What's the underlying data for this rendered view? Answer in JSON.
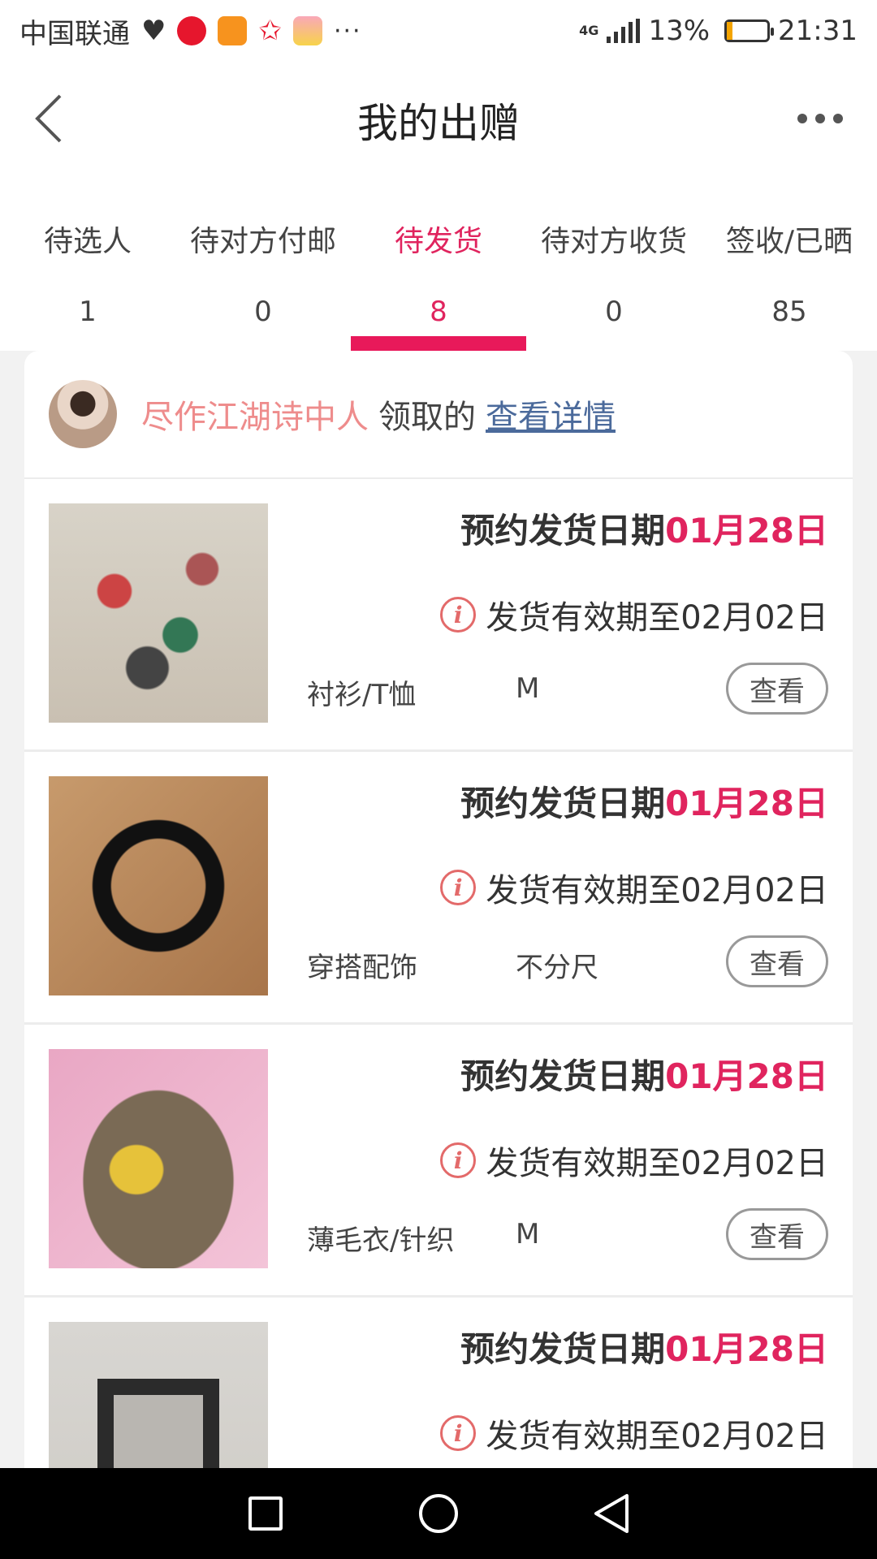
{
  "status_bar": {
    "carrier": "中国联通",
    "more": "···",
    "network": "4G",
    "battery_pct": "13%",
    "battery_level": 0.13,
    "time": "21:31"
  },
  "nav": {
    "title": "我的出赠"
  },
  "tabs": [
    {
      "label": "待选人",
      "count": "1"
    },
    {
      "label": "待对方付邮",
      "count": "0"
    },
    {
      "label": "待发货",
      "count": "8",
      "active": true
    },
    {
      "label": "待对方收货",
      "count": "0"
    },
    {
      "label": "签收/已晒",
      "count": "85"
    }
  ],
  "receiver": {
    "name": "尽作江湖诗中人",
    "claimed_text": "领取的",
    "detail_link": "查看详情"
  },
  "items": [
    {
      "ship_label": "预约发货日期",
      "ship_date": "01月28日",
      "valid_text": "发货有效期至02月02日",
      "category": "衬衫/T恤",
      "size": "M",
      "view_label": "查看"
    },
    {
      "ship_label": "预约发货日期",
      "ship_date": "01月28日",
      "valid_text": "发货有效期至02月02日",
      "category": "穿搭配饰",
      "size": "不分尺",
      "view_label": "查看"
    },
    {
      "ship_label": "预约发货日期",
      "ship_date": "01月28日",
      "valid_text": "发货有效期至02月02日",
      "category": "薄毛衣/针织",
      "size": "M",
      "view_label": "查看"
    },
    {
      "ship_label": "预约发货日期",
      "ship_date": "01月28日",
      "valid_text": "发货有效期至02月02日"
    }
  ],
  "colors": {
    "accent": "#e8195a",
    "receiver_name": "#ee8c8c",
    "link": "#4b6a9b",
    "info_icon": "#e36a6a"
  },
  "icons": {
    "back": "chevron-left-icon",
    "more": "more-dots-icon",
    "info": "info-icon",
    "sys_recent": "square-icon",
    "sys_home": "circle-icon",
    "sys_back": "triangle-back-icon"
  }
}
